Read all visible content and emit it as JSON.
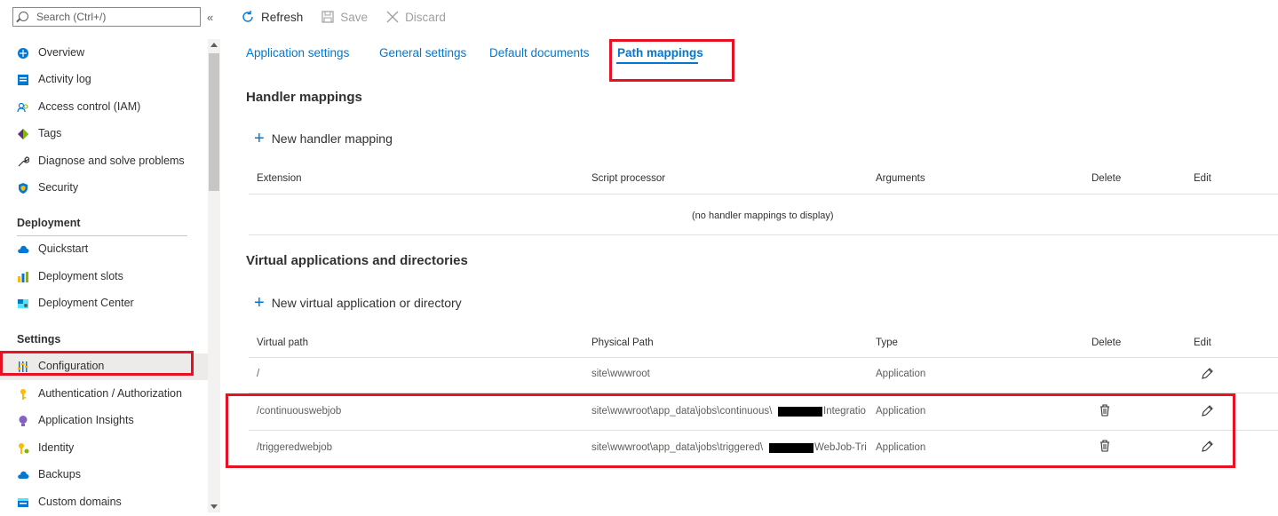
{
  "sidebar": {
    "search_placeholder": "Search (Ctrl+/)",
    "collapse_glyph": "«",
    "items_top": [
      {
        "label": "Overview",
        "icon": "overview-icon"
      },
      {
        "label": "Activity log",
        "icon": "activity-log-icon"
      },
      {
        "label": "Access control (IAM)",
        "icon": "iam-icon"
      },
      {
        "label": "Tags",
        "icon": "tag-icon"
      },
      {
        "label": "Diagnose and solve problems",
        "icon": "wrench-icon"
      },
      {
        "label": "Security",
        "icon": "shield-icon"
      }
    ],
    "section_deployment": "Deployment",
    "items_deployment": [
      {
        "label": "Quickstart",
        "icon": "cloud-icon"
      },
      {
        "label": "Deployment slots",
        "icon": "slots-icon"
      },
      {
        "label": "Deployment Center",
        "icon": "deployment-center-icon"
      }
    ],
    "section_settings": "Settings",
    "items_settings": [
      {
        "label": "Configuration",
        "icon": "sliders-icon"
      },
      {
        "label": "Authentication / Authorization",
        "icon": "key-icon"
      },
      {
        "label": "Application Insights",
        "icon": "bulb-icon"
      },
      {
        "label": "Identity",
        "icon": "identity-key-icon"
      },
      {
        "label": "Backups",
        "icon": "backup-cloud-icon"
      },
      {
        "label": "Custom domains",
        "icon": "domain-icon"
      }
    ]
  },
  "toolbar": {
    "refresh_label": "Refresh",
    "save_label": "Save",
    "discard_label": "Discard"
  },
  "tabs": [
    {
      "label": "Application settings"
    },
    {
      "label": "General settings"
    },
    {
      "label": "Default documents"
    },
    {
      "label": "Path mappings",
      "active": true
    }
  ],
  "handler": {
    "heading": "Handler mappings",
    "add_label": "New handler mapping",
    "columns": [
      "Extension",
      "Script processor",
      "Arguments",
      "Delete",
      "Edit"
    ],
    "empty_text": "(no handler mappings to display)"
  },
  "virtual": {
    "heading": "Virtual applications and directories",
    "add_label": "New virtual application or directory",
    "columns": [
      "Virtual path",
      "Physical Path",
      "Type",
      "Delete",
      "Edit"
    ],
    "rows": [
      {
        "virtual_path": "/",
        "physical_prefix": "site\\wwwroot",
        "physical_suffix": "",
        "type": "Application"
      },
      {
        "virtual_path": "/continuouswebjob",
        "physical_prefix": "site\\wwwroot\\app_data\\jobs\\continuous\\",
        "physical_suffix": "Integratio",
        "type": "Application"
      },
      {
        "virtual_path": "/triggeredwebjob",
        "physical_prefix": "site\\wwwroot\\app_data\\jobs\\triggered\\",
        "physical_suffix": "WebJob-Tri",
        "type": "Application"
      }
    ]
  },
  "colors": {
    "accent": "#0078d4",
    "highlight": "#e81123",
    "active_nav_bg": "#edebe9"
  }
}
